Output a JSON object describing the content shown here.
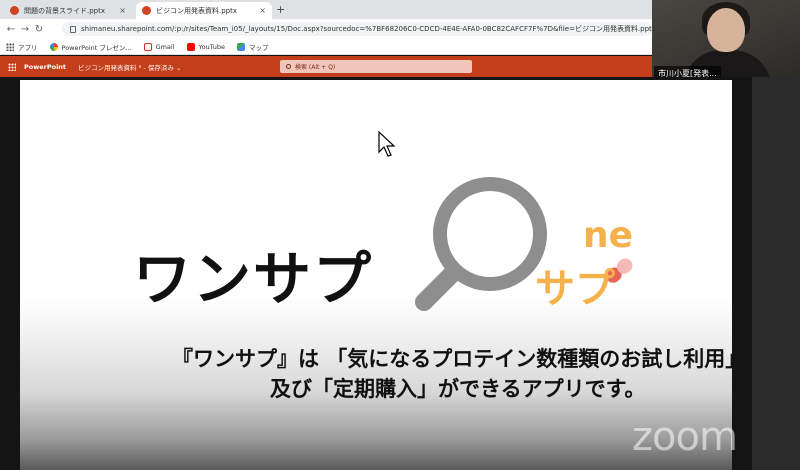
{
  "browser": {
    "tabs": [
      {
        "label": "問題の背景スライド.pptx",
        "close": "×"
      },
      {
        "label": "ビジコン用発表資料.pptx",
        "close": "×"
      }
    ],
    "new_tab": "+",
    "url": "shimaneu.sharepoint.com/:p:/r/sites/Team_i05/_layouts/15/Doc.aspx?sourcedoc=%7BF68206C0-CDCD-4E4E-AFA0-0BC82CAFCF7F%7D&file=ビジコン用発表資料.ppt...",
    "bookmarks": [
      {
        "label": "アプリ",
        "icon": "apps-grid-icon"
      },
      {
        "label": "PowerPoint プレゼン...",
        "icon": "google-icon"
      },
      {
        "label": "Gmail",
        "icon": "gmail-icon"
      },
      {
        "label": "YouTube",
        "icon": "youtube-icon"
      },
      {
        "label": "マップ",
        "icon": "maps-icon"
      }
    ]
  },
  "powerpoint": {
    "app_name": "PowerPoint",
    "doc_title": "ビジコン用発表資料 ᴿ - 保存済み ⌄",
    "search_placeholder": "検索 (Alt + Q)"
  },
  "webcam": {
    "participant_name": "市川小夏[発表..."
  },
  "slide": {
    "title": "ワンサプ",
    "logo_ne": "ne",
    "logo_sub": "サプ",
    "description_line1": "『ワンサプ』は 「気になるプロテイン数種類のお試し利用」",
    "description_line2": "及び「定期購入」ができるアプリです。"
  },
  "watermark": "zoom",
  "colors": {
    "ppt_ribbon": "#c43e1c",
    "logo_orange": "#f5b14c",
    "magnifier_gray": "#8e8e8e",
    "capsule_red": "#e8635a"
  }
}
